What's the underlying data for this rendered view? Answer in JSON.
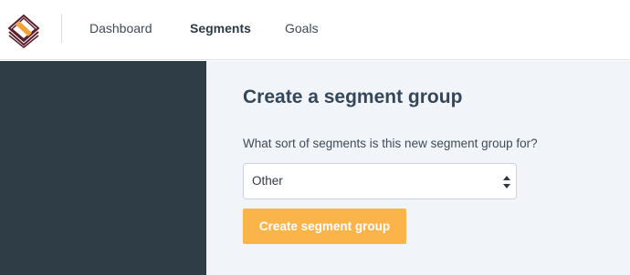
{
  "header": {
    "logo_icon": "stacked-layers-logo-icon",
    "nav": [
      {
        "label": "Dashboard",
        "active": false
      },
      {
        "label": "Segments",
        "active": true
      },
      {
        "label": "Goals",
        "active": false
      }
    ]
  },
  "main": {
    "title": "Create a segment group",
    "question": "What sort of segments is this new segment group for?",
    "segment_type_select": {
      "value": "Other",
      "arrow_icon": "up-down-arrows-icon"
    },
    "create_button_label": "Create segment group"
  },
  "colors": {
    "sidebar": "#2f3d47",
    "main_bg": "#f1f4f8",
    "accent_button": "#fbb44a",
    "logo_orange": "#f4a23c",
    "logo_dark": "#5a1f2e"
  }
}
